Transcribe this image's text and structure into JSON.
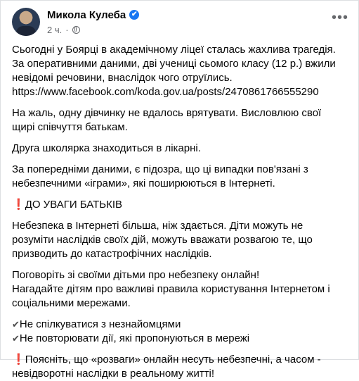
{
  "post": {
    "author": "Микола Кулеба",
    "time": "2 ч.",
    "dot": "·",
    "more_label": "•••",
    "icons": {
      "verified": "✔",
      "globe": "globe-icon",
      "warning": "❗",
      "check": "✔"
    },
    "paragraphs": {
      "p1_l1": "Сьогодні у Боярці в академічному ліцеї сталась жахлива трагедія.",
      "p1_l2": "За оперативними даними, дві учениці сьомого класу (12 р.) вжили",
      "p1_l3": "невідомі речовини, внаслідок чого отруїлись.",
      "p1_link": "https://www.facebook.com/koda.gov.ua/posts/2470861766555290",
      "p2_l1": "На жаль, одну дівчинку не вдалось врятувати. Висловлюю свої",
      "p2_l2": "щирі співчуття батькам.",
      "p3": "Друга школярка знаходиться в лікарні.",
      "p4_l1": "За попередніми даними, є підозра, що ці випадки пов'язані з",
      "p4_l2": "небезпечними «іграми», які поширюються в Інтернеті.",
      "p5": "ДО УВАГИ БАТЬКІВ",
      "p6_l1": "Небезпека в Інтернеті більша, ніж здається. Діти можуть не",
      "p6_l2": "розуміти наслідків своїх дій, можуть вважати розвагою те, що",
      "p6_l3": "призводить до катастрофічних наслідків.",
      "p7_l1": "Поговоріть зі своїми дітьми про небезпеку онлайн!",
      "p7_l2": "Нагадайте дітям про важливі правила користування Інтернетом і",
      "p7_l3": "соціальними мережами.",
      "c1": "Не спілкуватися з незнайомцями",
      "c2": "Не повторювати дії, які пропонуються в мережі",
      "p8_l1": "Поясніть, що «розваги» онлайн несуть небезпечні, а часом -",
      "p8_l2": "невідворотні наслідки в реальному житті!"
    }
  }
}
